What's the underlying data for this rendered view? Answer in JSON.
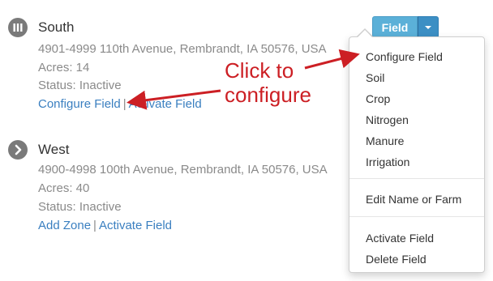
{
  "fields": [
    {
      "name": "South",
      "icon": "bar-chart-icon",
      "address": "4901-4999 110th Avenue, Rembrandt, IA 50576, USA",
      "acres": "Acres: 14",
      "status": "Status: Inactive",
      "link1": "Configure Field",
      "link2": "Activate Field"
    },
    {
      "name": "West",
      "icon": "chevron-right-icon",
      "address": "4900-4998 100th Avenue, Rembrandt, IA 50576, USA",
      "acres": "Acres: 40",
      "status": "Status: Inactive",
      "link1": "Add Zone",
      "link2": "Activate Field"
    }
  ],
  "separator": "|",
  "field_button": {
    "label": "Field"
  },
  "menu": {
    "items": [
      "Configure Field",
      "Soil",
      "Crop",
      "Nitrogen",
      "Manure",
      "Irrigation",
      "Edit Name or Farm",
      "Activate Field",
      "Delete Field"
    ]
  },
  "annotation": {
    "line1": "Click to",
    "line2": "configure",
    "color": "#cc1f24"
  },
  "colors": {
    "link": "#3a7fc0",
    "button": "#5bb0d8",
    "muted": "#8a8a8a"
  }
}
